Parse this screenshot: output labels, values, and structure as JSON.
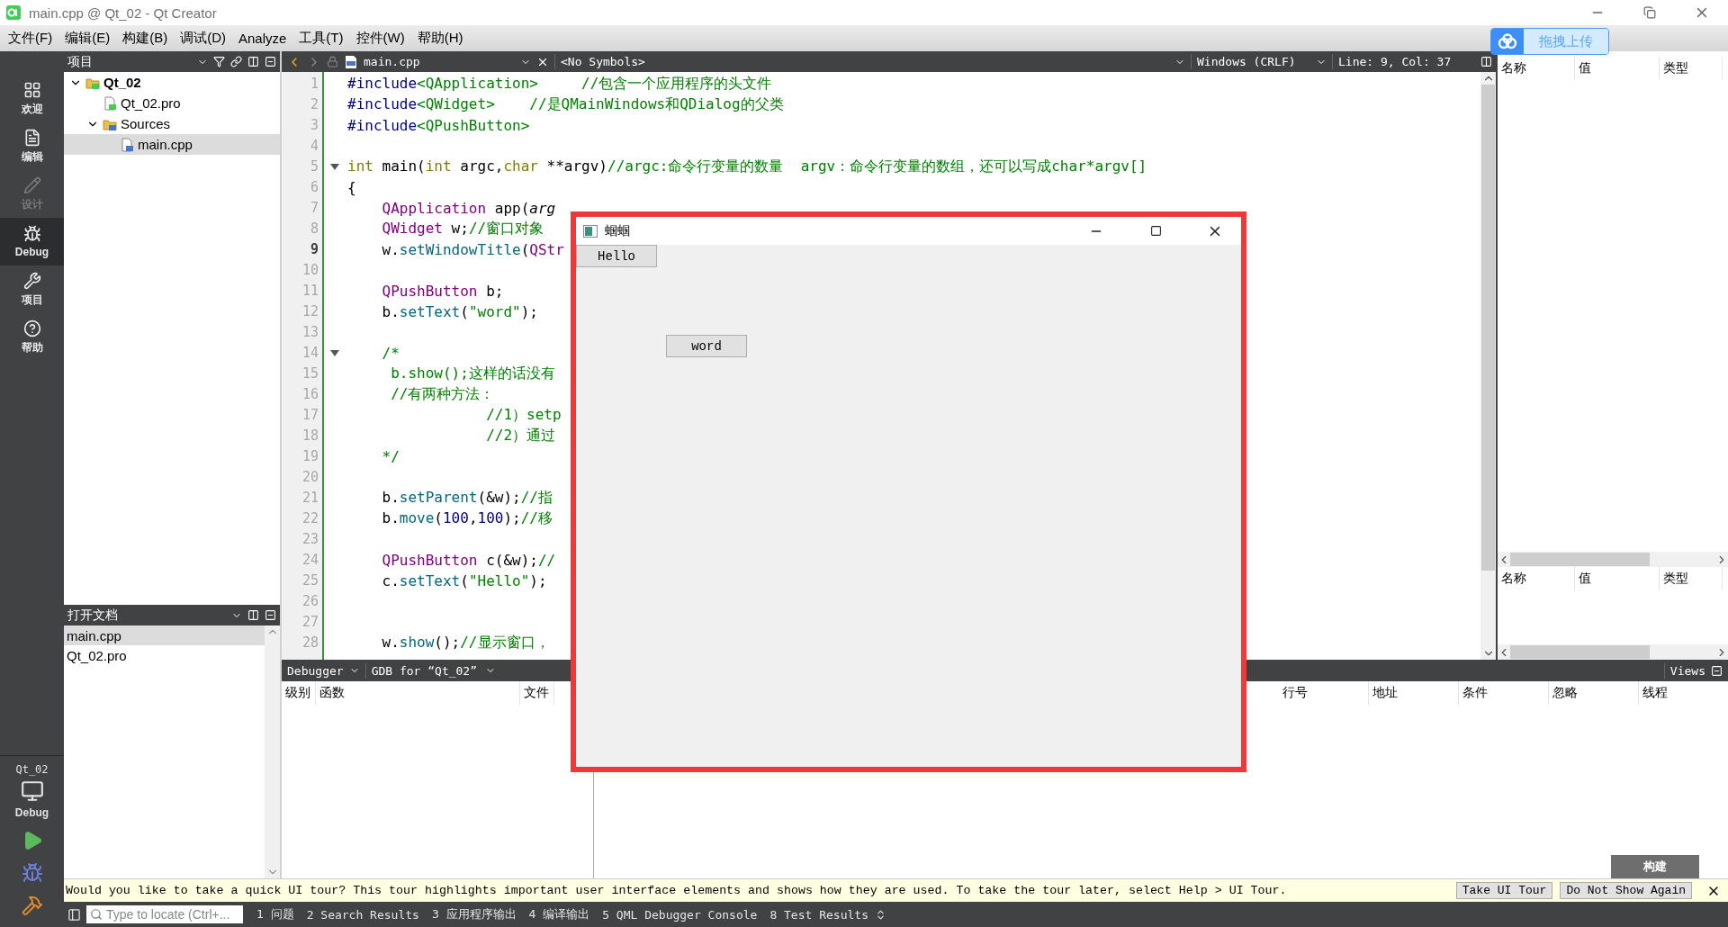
{
  "window": {
    "title": "main.cpp @ Qt_02 - Qt Creator"
  },
  "menu": [
    "文件(F)",
    "编辑(E)",
    "构建(B)",
    "调试(D)",
    "Analyze",
    "工具(T)",
    "控件(W)",
    "帮助(H)"
  ],
  "upload_button": {
    "label": "拖拽上传"
  },
  "mode_bar": {
    "items": [
      {
        "label": "欢迎",
        "selected": false,
        "disabled": false
      },
      {
        "label": "编辑",
        "selected": false,
        "disabled": false
      },
      {
        "label": "设计",
        "selected": false,
        "disabled": true
      },
      {
        "label": "Debug",
        "selected": true,
        "disabled": false
      },
      {
        "label": "项目",
        "selected": false,
        "disabled": false
      },
      {
        "label": "帮助",
        "selected": false,
        "disabled": false
      }
    ],
    "target": {
      "project": "Qt_02",
      "config": "Debug"
    }
  },
  "project_panel": {
    "title": "项目",
    "tree": [
      {
        "label": "Qt_02",
        "kind": "project",
        "expanded": true,
        "selected": false,
        "children": [
          {
            "label": "Qt_02.pro",
            "kind": "pro",
            "selected": false
          },
          {
            "label": "Sources",
            "kind": "folder",
            "expanded": true,
            "selected": false,
            "children": [
              {
                "label": "main.cpp",
                "kind": "source",
                "selected": true
              }
            ]
          }
        ]
      }
    ]
  },
  "open_documents": {
    "title": "打开文档",
    "items": [
      {
        "label": "main.cpp",
        "selected": true
      },
      {
        "label": "Qt_02.pro",
        "selected": false
      }
    ]
  },
  "editor": {
    "file": "main.cpp",
    "symbols": "<No Symbols>",
    "line_ending": "Windows (CRLF)",
    "position": "Line: 9, Col: 37",
    "lines": [
      {
        "n": "1",
        "current": false,
        "fold": false,
        "tokens": [
          {
            "t": "#include",
            "kind": "preproc"
          },
          {
            "t": "<QApplication>",
            "kind": "include"
          },
          {
            "t": "     //包含一个应用程序的头文件",
            "kind": "comment"
          }
        ]
      },
      {
        "n": "2",
        "current": false,
        "fold": false,
        "tokens": [
          {
            "t": "#include",
            "kind": "preproc"
          },
          {
            "t": "<QWidget>",
            "kind": "include"
          },
          {
            "t": "    //是QMainWindows和QDialog的父类",
            "kind": "comment"
          }
        ]
      },
      {
        "n": "3",
        "current": false,
        "fold": false,
        "tokens": [
          {
            "t": "#include",
            "kind": "preproc"
          },
          {
            "t": "<QPushButton>",
            "kind": "include"
          }
        ]
      },
      {
        "n": "4",
        "current": false,
        "fold": false
      },
      {
        "n": "5",
        "current": false,
        "fold": true,
        "tokens": [
          {
            "t": "int",
            "kind": "keyword"
          },
          {
            "t": " main(",
            "kind": "plain"
          },
          {
            "t": "int",
            "kind": "keyword"
          },
          {
            "t": " argc,",
            "kind": "plain"
          },
          {
            "t": "char",
            "kind": "keyword"
          },
          {
            "t": " **argv)",
            "kind": "plain"
          },
          {
            "t": "//argc:命令行变量的数量  argv：命令行变量的数组，还可以写成char*argv[]",
            "kind": "comment"
          }
        ]
      },
      {
        "n": "6",
        "current": false,
        "fold": false,
        "tokens": [
          {
            "t": "{",
            "kind": "plain"
          }
        ]
      },
      {
        "n": "7",
        "current": false,
        "fold": false,
        "tokens": [
          {
            "t": "    QApplication",
            "kind": "type"
          },
          {
            "t": " app(",
            "kind": "plain"
          },
          {
            "t": "arg",
            "kind": "param"
          }
        ]
      },
      {
        "n": "8",
        "current": false,
        "fold": false,
        "tokens": [
          {
            "t": "    QWidget",
            "kind": "type"
          },
          {
            "t": " w;",
            "kind": "plain"
          },
          {
            "t": "//窗口对象",
            "kind": "comment"
          }
        ]
      },
      {
        "n": "9",
        "current": true,
        "fold": false,
        "tokens": [
          {
            "t": "    w.",
            "kind": "plain"
          },
          {
            "t": "setWindowTitle",
            "kind": "func"
          },
          {
            "t": "(",
            "kind": "plain"
          },
          {
            "t": "QStr",
            "kind": "type"
          }
        ]
      },
      {
        "n": "10",
        "current": false,
        "fold": false
      },
      {
        "n": "11",
        "current": false,
        "fold": false,
        "tokens": [
          {
            "t": "    QPushButton",
            "kind": "type"
          },
          {
            "t": " b;",
            "kind": "plain"
          }
        ]
      },
      {
        "n": "12",
        "current": false,
        "fold": false,
        "tokens": [
          {
            "t": "    b.",
            "kind": "plain"
          },
          {
            "t": "setText",
            "kind": "func"
          },
          {
            "t": "(",
            "kind": "plain"
          },
          {
            "t": "\"word\"",
            "kind": "string"
          },
          {
            "t": ");",
            "kind": "plain"
          }
        ]
      },
      {
        "n": "13",
        "current": false,
        "fold": false
      },
      {
        "n": "14",
        "current": false,
        "fold": true,
        "tokens": [
          {
            "t": "    /*",
            "kind": "comment"
          }
        ]
      },
      {
        "n": "15",
        "current": false,
        "fold": false,
        "tokens": [
          {
            "t": "     b.show();这样的话没有",
            "kind": "comment"
          }
        ]
      },
      {
        "n": "16",
        "current": false,
        "fold": false,
        "tokens": [
          {
            "t": "     //有两种方法：",
            "kind": "comment"
          }
        ]
      },
      {
        "n": "17",
        "current": false,
        "fold": false,
        "tokens": [
          {
            "t": "                //1）setp",
            "kind": "comment"
          }
        ]
      },
      {
        "n": "18",
        "current": false,
        "fold": false,
        "tokens": [
          {
            "t": "                //2）通过",
            "kind": "comment"
          }
        ]
      },
      {
        "n": "19",
        "current": false,
        "fold": false,
        "tokens": [
          {
            "t": "    */",
            "kind": "comment"
          }
        ]
      },
      {
        "n": "20",
        "current": false,
        "fold": false
      },
      {
        "n": "21",
        "current": false,
        "fold": false,
        "tokens": [
          {
            "t": "    b.",
            "kind": "plain"
          },
          {
            "t": "setParent",
            "kind": "func"
          },
          {
            "t": "(&w);",
            "kind": "plain"
          },
          {
            "t": "//指",
            "kind": "comment"
          }
        ]
      },
      {
        "n": "22",
        "current": false,
        "fold": false,
        "tokens": [
          {
            "t": "    b.",
            "kind": "plain"
          },
          {
            "t": "move",
            "kind": "func"
          },
          {
            "t": "(",
            "kind": "plain"
          },
          {
            "t": "100",
            "kind": "number"
          },
          {
            "t": ",",
            "kind": "plain"
          },
          {
            "t": "100",
            "kind": "number"
          },
          {
            "t": ");",
            "kind": "plain"
          },
          {
            "t": "//移",
            "kind": "comment"
          }
        ]
      },
      {
        "n": "23",
        "current": false,
        "fold": false
      },
      {
        "n": "24",
        "current": false,
        "fold": false,
        "tokens": [
          {
            "t": "    QPushButton",
            "kind": "type"
          },
          {
            "t": " c(&w);",
            "kind": "plain"
          },
          {
            "t": "//",
            "kind": "comment"
          }
        ]
      },
      {
        "n": "25",
        "current": false,
        "fold": false,
        "tokens": [
          {
            "t": "    c.",
            "kind": "plain"
          },
          {
            "t": "setText",
            "kind": "func"
          },
          {
            "t": "(",
            "kind": "plain"
          },
          {
            "t": "\"Hello\"",
            "kind": "string"
          },
          {
            "t": ");",
            "kind": "plain"
          }
        ]
      },
      {
        "n": "26",
        "current": false,
        "fold": false
      },
      {
        "n": "27",
        "current": false,
        "fold": false
      },
      {
        "n": "28",
        "current": false,
        "fold": false,
        "tokens": [
          {
            "t": "    w.",
            "kind": "plain"
          },
          {
            "t": "show",
            "kind": "func"
          },
          {
            "t": "();",
            "kind": "plain"
          },
          {
            "t": "//显示窗口，",
            "kind": "comment"
          }
        ]
      }
    ]
  },
  "locals_panel": {
    "columns": [
      "名称",
      "值",
      "类型"
    ]
  },
  "expressions_panel": {
    "columns": [
      "名称",
      "值",
      "类型"
    ]
  },
  "debugger_bar": {
    "mode": "Debugger",
    "engine": "GDB for “Qt_02”",
    "views": "Views"
  },
  "stack_table": {
    "columns": [
      "级别",
      "函数",
      "文件"
    ]
  },
  "breakpoint_table": {
    "columns": [
      "行号",
      "地址",
      "条件",
      "忽略",
      "线程"
    ]
  },
  "tooltip": {
    "text": "构建"
  },
  "tour_bar": {
    "message": "Would you like to take a quick UI tour? This tour highlights important user interface elements and shows how they are used. To take the tour later, select Help > UI Tour.",
    "buttons": [
      "Take UI Tour",
      "Do Not Show Again"
    ]
  },
  "status_bar": {
    "locate_placeholder": "Type to locate (Ctrl+...",
    "tabs": [
      "1 问题",
      "2 Search Results",
      "3 应用程序输出",
      "4 编译输出",
      "5 QML Debugger Console",
      "8 Test Results"
    ]
  },
  "app_window": {
    "title": "蝈蝈",
    "buttons": [
      "Hello",
      "word"
    ]
  }
}
